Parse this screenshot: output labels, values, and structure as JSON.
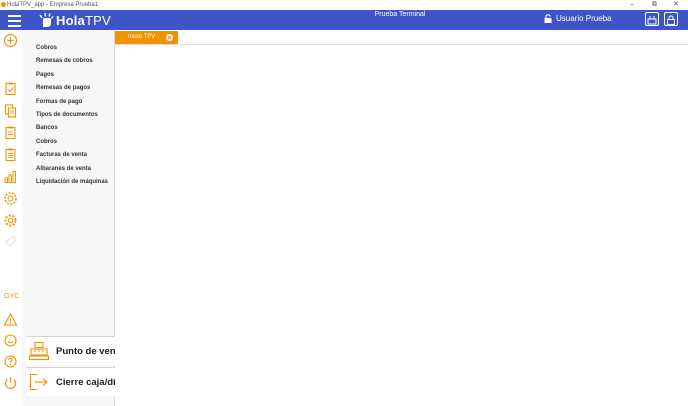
{
  "window": {
    "title": "HolaTPV_app - Empresa Prueba1",
    "controls": [
      "minimize-icon",
      "restore-icon",
      "close-icon"
    ]
  },
  "header": {
    "logo_bold": "Hola",
    "logo_light": "TPV",
    "terminal": "Prueba Terminal",
    "user": "Usuario Prueba",
    "accent": "#3d55c6"
  },
  "sidebar_icons": {
    "items": [
      "add-icon",
      "clipboard-check-icon",
      "documents-icon",
      "clipboard-icon",
      "clipboard-list-icon",
      "bar-chart-icon",
      "gear-group-icon",
      "gear-icon",
      "tag-icon"
    ],
    "bottom": [
      "warning-icon",
      "smiley-icon",
      "help-icon",
      "power-icon"
    ],
    "gyc": "GYC",
    "accent": "#f39200"
  },
  "menu": {
    "items": [
      "Cobros",
      "Remesas de cobros",
      "Pagos",
      "Remesas de pagos",
      "Formas de pago",
      "Tipos de documentos",
      "Bancos",
      "Cobros",
      "Facturas de venta",
      "Albaranes de venta",
      "Liquidación de máquinas"
    ],
    "pos_button": "Punto de venta",
    "close_button": "Cierre caja/día"
  },
  "tabs": [
    {
      "label": "Inicio TPV"
    }
  ]
}
